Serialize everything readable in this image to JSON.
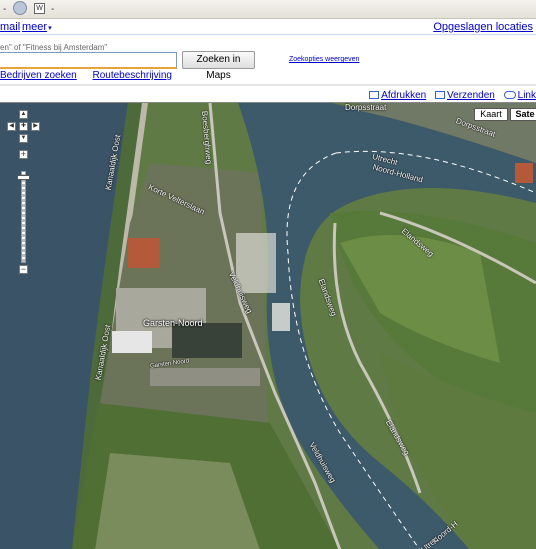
{
  "browser": {
    "toolbar_items": [
      "-",
      "W",
      "-"
    ]
  },
  "header": {
    "mail": "mail",
    "more": "meer",
    "saved_locations": "Opgeslagen locaties"
  },
  "search": {
    "hint": "en\" of \"Fitness bij Amsterdam\"",
    "value": "",
    "button": "Zoeken in Maps",
    "options": "Zoekopties weergeven"
  },
  "sub_links": {
    "find_business": "Bedrijven zoeken",
    "directions": "Routebeschrijving"
  },
  "actions": {
    "print": "Afdrukken",
    "send": "Verzenden",
    "link": "Link"
  },
  "map": {
    "type_buttons": {
      "map": "Kaart",
      "satellite": "Sate"
    },
    "selected_type": "satellite",
    "street_labels": {
      "dorpsstraat_top": "Dorpsstraat",
      "dorpsstraat_right": "Dorpsstraat",
      "utrecht": "Utrecht",
      "noord_holland": "Noord-Holland",
      "kanaaldijk_oost": "Kanaaldijk Oost",
      "kanaaldijk_oost_2": "Kanaaldijk Oost",
      "korte_velterslaan": "Korte Velterslaan",
      "boesberghweg": "Boesberghweg",
      "veldhuisweg": "Veldhuisweg",
      "garsten_noord_road": "Garsten Noord",
      "elandsweg": "Elandsweg",
      "elandsweg_2": "Elandsweg",
      "elandsweg_3": "Elandsweg",
      "veldhuisweg_2": "Veldhuisweg",
      "noord_holland_2": "Noord-H",
      "utrecht_2": "Utrec"
    },
    "place_label": "Garsten-Noord",
    "colors": {
      "water": "#3b5568",
      "field": "#5f7a45",
      "road": "#c9c6bb",
      "boundary": "#ffffff"
    }
  }
}
